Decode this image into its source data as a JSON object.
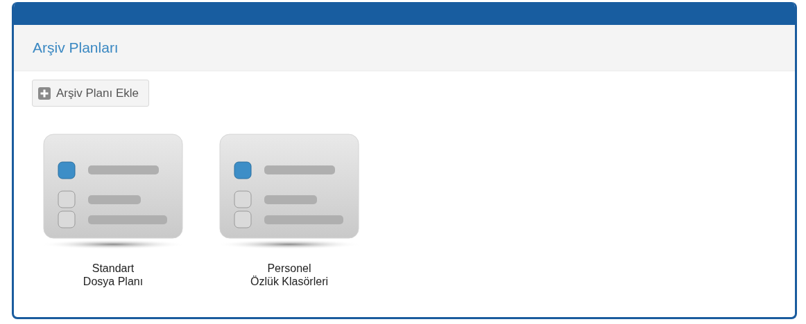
{
  "panel": {
    "title": "Arşiv Planları"
  },
  "toolbar": {
    "add_button": "Arşiv Planı Ekle"
  },
  "plans": [
    {
      "label_lines": [
        "Standart",
        "Dosya Planı"
      ]
    },
    {
      "label_lines": [
        "Personel",
        "Özlük Klasörleri"
      ]
    }
  ]
}
